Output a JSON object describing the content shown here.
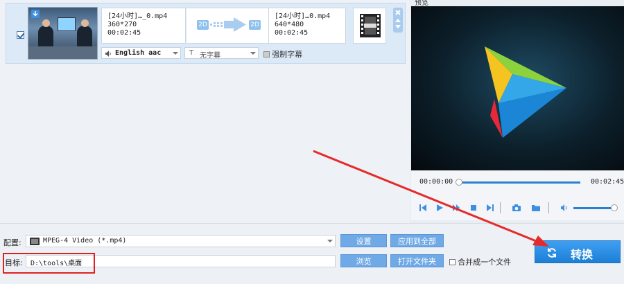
{
  "file": {
    "src_name": "[24小时]…_0.mp4",
    "src_resolution": "360*270",
    "src_duration": "00:02:45",
    "dst_name": "[24小时]…0.mp4",
    "dst_resolution": "640*480",
    "dst_duration": "00:02:45",
    "badge_src": "2D",
    "badge_dst": "2D",
    "audio_track": "English aac",
    "subtitle": "无字幕",
    "force_subtitle": "强制字幕"
  },
  "preview": {
    "title": "预览",
    "time_current": "00:00:00",
    "time_total": "00:02:45",
    "progress": 0.0,
    "volume": 0.95
  },
  "bottom": {
    "profile_label": "配置:",
    "profile_value": "MPEG-4 Video (*.mp4)",
    "settings_button": "设置",
    "apply_all_button": "应用到全部",
    "target_label": "目标:",
    "target_value": "D:\\tools\\桌面",
    "browse_button": "浏览",
    "open_folder_button": "打开文件夹",
    "merge_label": "合并成一个文件",
    "convert_button": "转换"
  },
  "colors": {
    "accent": "#6fa9e6",
    "convert": "#1c7fd6",
    "highlight": "#e02020"
  }
}
